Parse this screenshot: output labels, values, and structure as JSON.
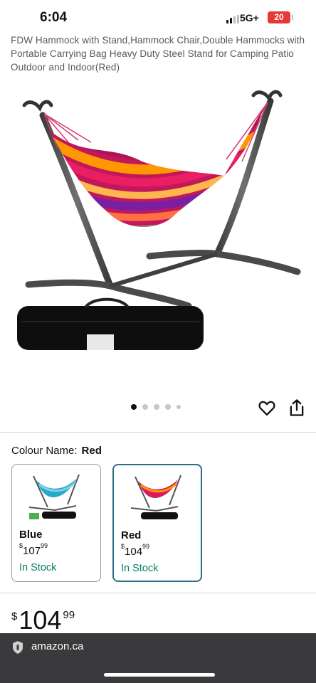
{
  "status_bar": {
    "time": "6:04",
    "network": "5G+",
    "battery": "20"
  },
  "product": {
    "title": "FDW Hammock with Stand,Hammock Chair,Double Hammocks with Portable Carrying Bag Heavy Duty Steel Stand for Camping Patio Outdoor and Indoor(Red)",
    "image_icon": "hammock-with-stand-image",
    "carousel_dots": 5,
    "carousel_active_index": 0
  },
  "actions": {
    "wishlist_icon": "heart-icon",
    "share_icon": "share-icon"
  },
  "variation": {
    "label": "Colour Name:",
    "selected_value": "Red",
    "options": [
      {
        "name": "Blue",
        "currency": "$",
        "price_whole": "107",
        "price_fraction": "99",
        "stock": "In Stock",
        "selected": false
      },
      {
        "name": "Red",
        "currency": "$",
        "price_whole": "104",
        "price_fraction": "99",
        "stock": "In Stock",
        "selected": true
      }
    ]
  },
  "price": {
    "currency": "$",
    "whole": "104",
    "fraction": "99"
  },
  "browser": {
    "url": "amazon.ca"
  },
  "colors": {
    "selected_border": "#2a6f8a",
    "in_stock": "#067d62",
    "bottom_bar": "#3a3a3c"
  }
}
